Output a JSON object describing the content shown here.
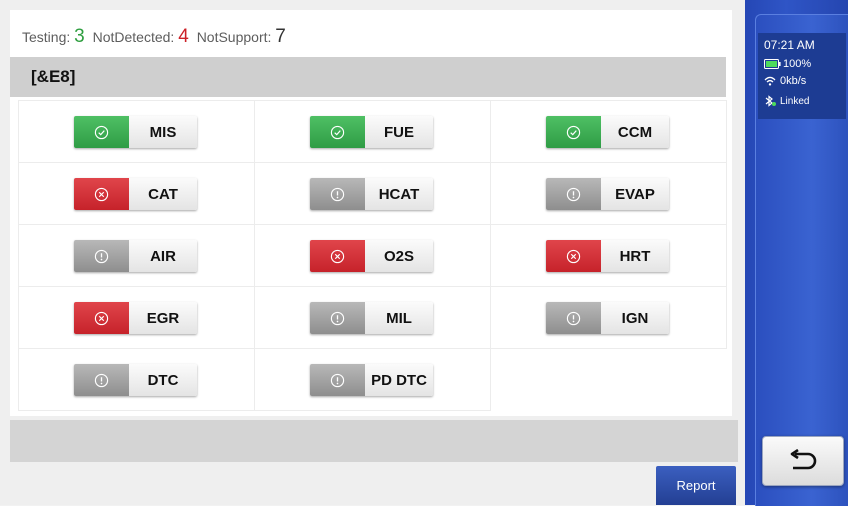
{
  "counts": {
    "testing_label": "Testing:",
    "testing_value": "3",
    "notdetected_label": "NotDetected:",
    "notdetected_value": "4",
    "notsupport_label": "NotSupport:",
    "notsupport_value": "7",
    "testing_color": "#2e9e3f",
    "notdetected_color": "#cc2027",
    "notsupport_color": "#333333"
  },
  "section": {
    "title": "[&E8]"
  },
  "monitors": [
    {
      "label": "MIS",
      "status": "testing"
    },
    {
      "label": "FUE",
      "status": "testing"
    },
    {
      "label": "CCM",
      "status": "testing"
    },
    {
      "label": "CAT",
      "status": "notdetected"
    },
    {
      "label": "HCAT",
      "status": "notsupport"
    },
    {
      "label": "EVAP",
      "status": "notsupport"
    },
    {
      "label": "AIR",
      "status": "notsupport"
    },
    {
      "label": "O2S",
      "status": "notdetected"
    },
    {
      "label": "HRT",
      "status": "notdetected"
    },
    {
      "label": "EGR",
      "status": "notdetected"
    },
    {
      "label": "MIL",
      "status": "notsupport"
    },
    {
      "label": "IGN",
      "status": "notsupport"
    },
    {
      "label": "DTC",
      "status": "notsupport"
    },
    {
      "label": "PD DTC",
      "status": "notsupport"
    }
  ],
  "icons": {
    "testing": "check-circle-icon",
    "notdetected": "x-circle-icon",
    "notsupport": "info-circle-icon"
  },
  "footer": {
    "report_label": "Report"
  },
  "status_bar": {
    "time": "07:21 AM",
    "battery": "100%",
    "network": "0kb/s",
    "link": "Linked"
  },
  "colors": {
    "testing": "#3aae52",
    "notdetected": "#d3303a",
    "notsupport": "#a3a3a3",
    "sidebar": "#2f55c6"
  }
}
